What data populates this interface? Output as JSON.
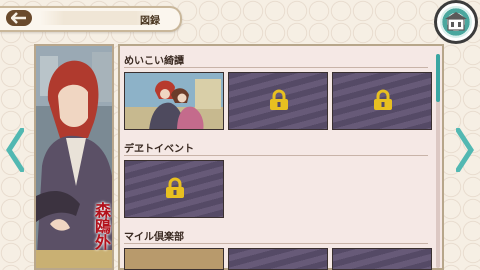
{
  "header": {
    "title": "図録",
    "back_icon": "back-arrow-icon"
  },
  "home": {
    "icon": "home-shrine-icon"
  },
  "character": {
    "name": "森鴎外"
  },
  "sections": [
    {
      "label": "めいこい綺譚",
      "items": [
        {
          "state": "unlocked"
        },
        {
          "state": "locked"
        },
        {
          "state": "locked"
        }
      ]
    },
    {
      "label": "デヱトイベント",
      "items": [
        {
          "state": "locked"
        }
      ]
    },
    {
      "label": "マイル倶楽部",
      "items": [
        {
          "state": "partial"
        },
        {
          "state": "partial"
        },
        {
          "state": "partial"
        }
      ]
    }
  ],
  "colors": {
    "accent": "#3aa6a2",
    "lock_gold": "#e8c020",
    "panel_bg": "#f5e8e5",
    "frame": "#b7a68a"
  }
}
